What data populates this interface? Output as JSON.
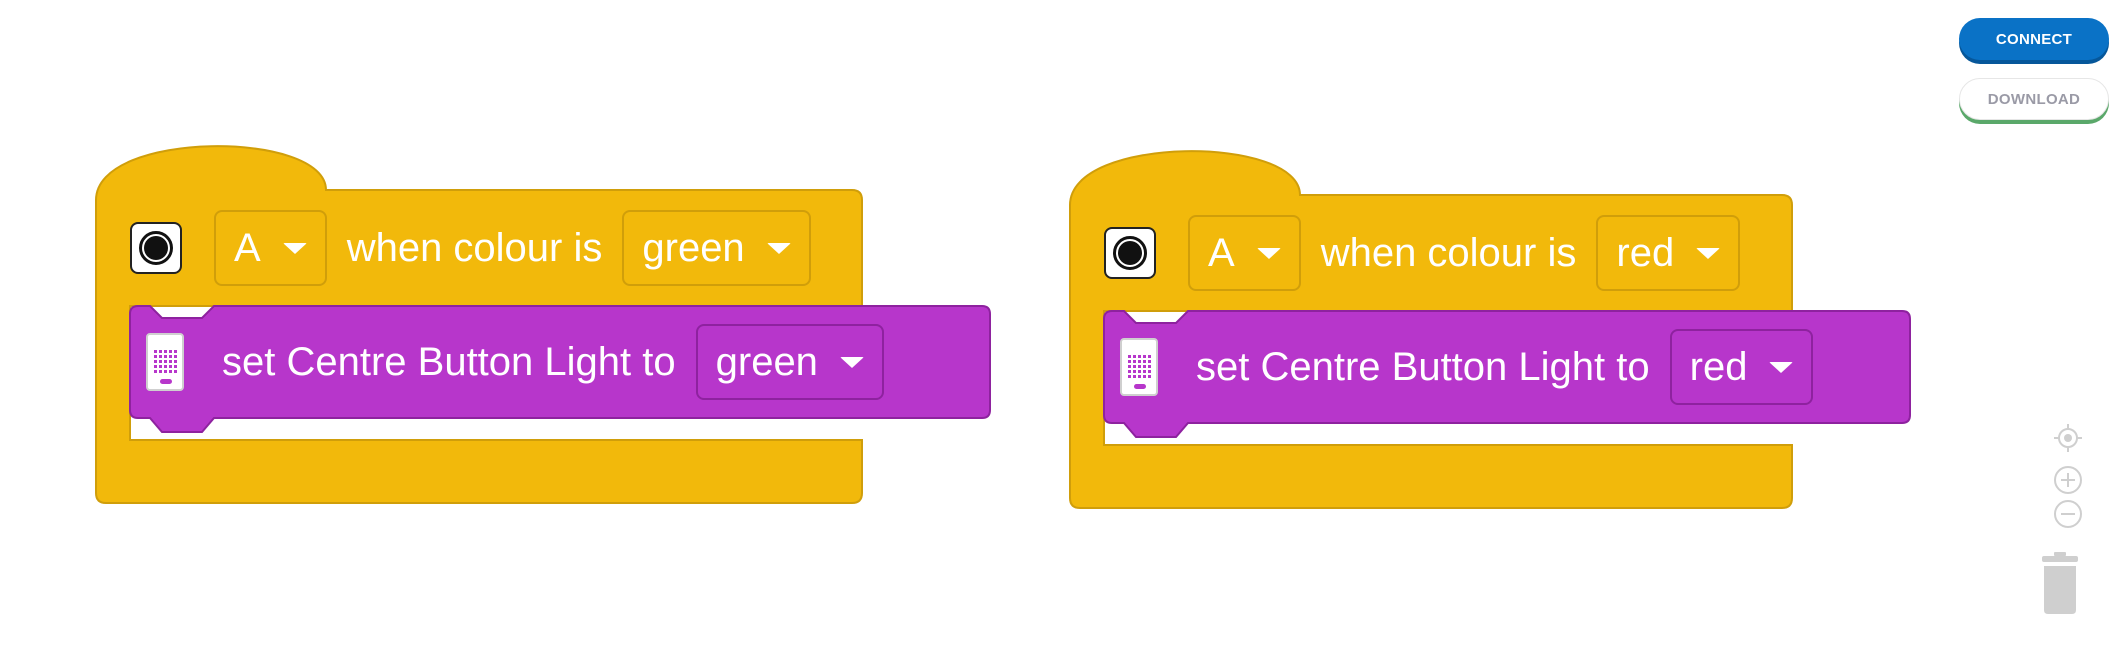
{
  "toolbar": {
    "connect_label": "CONNECT",
    "download_label": "DOWNLOAD"
  },
  "stacks": [
    {
      "hat": {
        "port": "A",
        "text": "when colour is",
        "colour": "green"
      },
      "command": {
        "text": "set Centre Button Light to",
        "colour": "green"
      }
    },
    {
      "hat": {
        "port": "A",
        "text": "when colour is",
        "colour": "red"
      },
      "command": {
        "text": "set Centre Button Light to",
        "colour": "red"
      }
    }
  ],
  "colors": {
    "event_block": "#f2b90b",
    "event_block_border": "#d09e0a",
    "light_block": "#b736cb",
    "light_block_border": "#8e229f",
    "connect_button": "#0a72c6"
  },
  "icons": {
    "sensor": "color-sensor-icon",
    "hub": "hub-light-icon",
    "recenter": "recenter-icon",
    "zoom_in": "zoom-in-icon",
    "zoom_out": "zoom-out-icon",
    "trash": "trash-icon"
  }
}
